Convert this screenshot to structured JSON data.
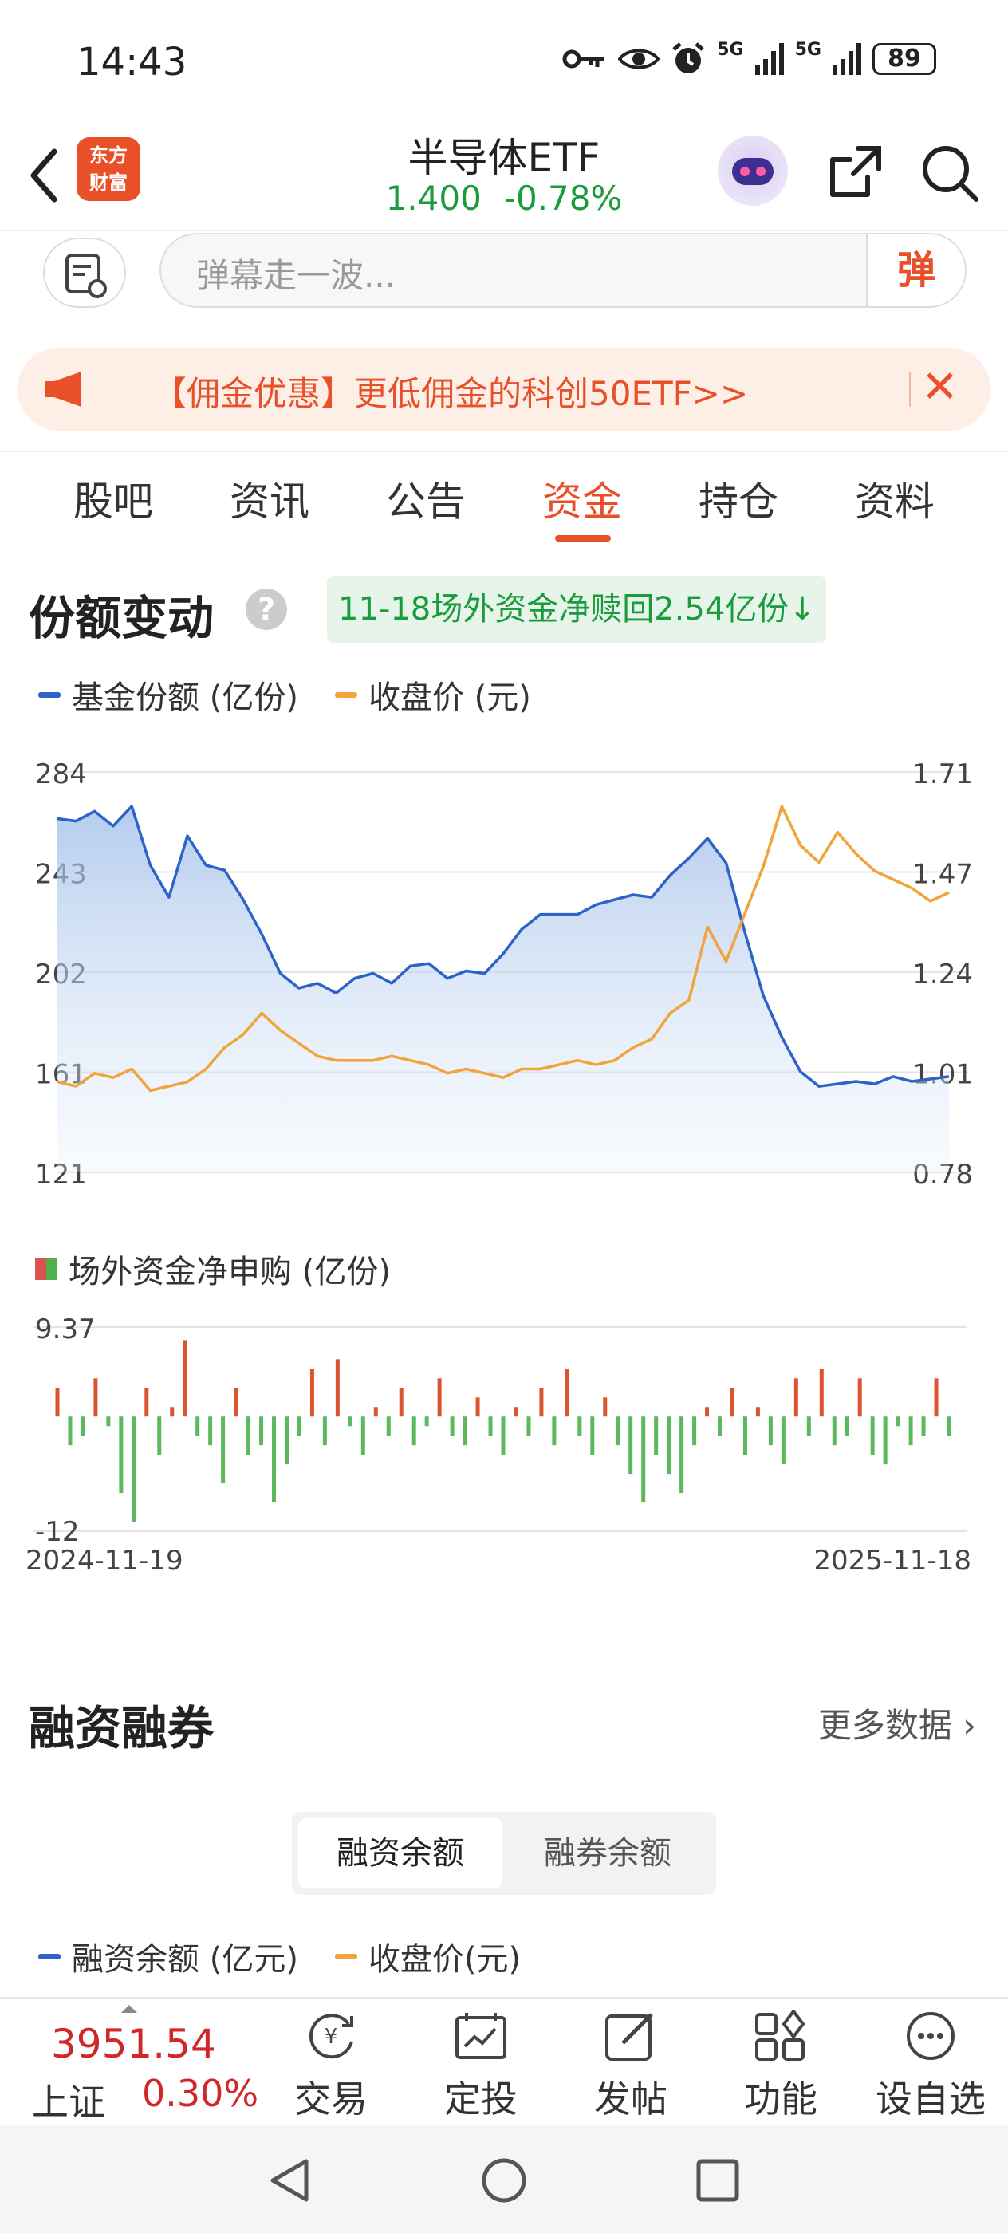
{
  "status_bar": {
    "time": "14:43",
    "battery": "89",
    "net1": "5G",
    "net2": "5G"
  },
  "header": {
    "logo_line1": "东方",
    "logo_line2": "财富",
    "title": "半导体ETF",
    "price": "1.400",
    "change": "-0.78%"
  },
  "danmu": {
    "placeholder": "弹幕走一波...",
    "button": "弹"
  },
  "promo": {
    "text": "【佣金优惠】更低佣金的科创50ETF>>",
    "close": "✕"
  },
  "tabs": [
    {
      "label": "股吧",
      "active": false
    },
    {
      "label": "资讯",
      "active": false
    },
    {
      "label": "公告",
      "active": false
    },
    {
      "label": "资金",
      "active": true
    },
    {
      "label": "持仓",
      "active": false
    },
    {
      "label": "资料",
      "active": false
    }
  ],
  "share_section": {
    "title": "份额变动",
    "help": "?",
    "badge": "11-18场外资金净赎回2.54亿份",
    "badge_arrow": "↓"
  },
  "colors": {
    "accent": "#e8502a",
    "blue": "#2d63c8",
    "orange": "#f0a43a",
    "green": "#1a9b3c",
    "red": "#d02828"
  },
  "chart_data": [
    {
      "type": "line",
      "legend": [
        "基金份额 (亿份)",
        "收盘价 (元)"
      ],
      "yticks_left": [
        "284",
        "243",
        "202",
        "161",
        "121"
      ],
      "yticks_right": [
        "1.71",
        "1.47",
        "1.24",
        "1.01",
        "0.78"
      ],
      "ylim_left": [
        121,
        284
      ],
      "ylim_right": [
        0.78,
        1.71
      ],
      "x_range": [
        "2024-11-19",
        "2025-11-18"
      ],
      "series": [
        {
          "name": "基金份额 (亿份)",
          "axis": "left",
          "values": [
            265,
            264,
            268,
            262,
            270,
            246,
            233,
            258,
            246,
            244,
            232,
            218,
            202,
            196,
            198,
            194,
            200,
            202,
            198,
            205,
            206,
            200,
            203,
            202,
            210,
            220,
            226,
            226,
            226,
            230,
            232,
            234,
            233,
            242,
            249,
            257,
            247,
            219,
            193,
            176,
            162,
            156,
            157,
            158,
            157,
            160,
            158,
            159,
            160
          ]
        },
        {
          "name": "收盘价 (元)",
          "axis": "right",
          "values": [
            0.99,
            0.98,
            1.01,
            1.0,
            1.02,
            0.97,
            0.98,
            0.99,
            1.02,
            1.07,
            1.1,
            1.15,
            1.11,
            1.08,
            1.05,
            1.04,
            1.04,
            1.04,
            1.05,
            1.04,
            1.03,
            1.01,
            1.02,
            1.01,
            1.0,
            1.02,
            1.02,
            1.03,
            1.04,
            1.03,
            1.04,
            1.07,
            1.09,
            1.15,
            1.18,
            1.35,
            1.27,
            1.38,
            1.49,
            1.63,
            1.54,
            1.5,
            1.57,
            1.52,
            1.48,
            1.46,
            1.44,
            1.41,
            1.43
          ]
        }
      ]
    },
    {
      "type": "bar",
      "legend": [
        "场外资金净申购 (亿份)"
      ],
      "yticks": [
        "9.37",
        "-12"
      ],
      "ylim": [
        -12,
        9.37
      ],
      "x_start": "2024-11-19",
      "x_end": "2025-11-18",
      "values": [
        3,
        -3,
        -2,
        4,
        -1,
        -8,
        -11,
        3,
        -4,
        1,
        8,
        -2,
        -3,
        -7,
        3,
        -4,
        -3,
        -9,
        -5,
        -2,
        5,
        -3,
        6,
        -1,
        -4,
        1,
        -2,
        3,
        -3,
        -1,
        4,
        -2,
        -3,
        2,
        -2,
        -4,
        1,
        -2,
        3,
        -3,
        5,
        -2,
        -4,
        2,
        -3,
        -6,
        -9,
        -4,
        -6,
        -8,
        -3,
        1,
        -2,
        3,
        -4,
        1,
        -3,
        -5,
        4,
        -2,
        5,
        -3,
        -2,
        4,
        -4,
        -5,
        -1,
        -3,
        -2,
        4,
        -2
      ]
    }
  ],
  "margin_section": {
    "title": "融资融券",
    "more": "更多数据",
    "seg_on": "融资余额",
    "seg_off": "融券余额",
    "legend1": "融资余额 (亿元)",
    "legend2": "收盘价(元)"
  },
  "bottom_bar": {
    "index_value": "3951.54",
    "index_name": "上证",
    "index_pct": "0.30%",
    "nav": [
      {
        "label": "交易",
        "icon": "trade-icon"
      },
      {
        "label": "定投",
        "icon": "auto-invest-icon"
      },
      {
        "label": "发帖",
        "icon": "post-icon"
      },
      {
        "label": "功能",
        "icon": "apps-icon"
      },
      {
        "label": "设自选",
        "icon": "more-icon"
      }
    ]
  }
}
